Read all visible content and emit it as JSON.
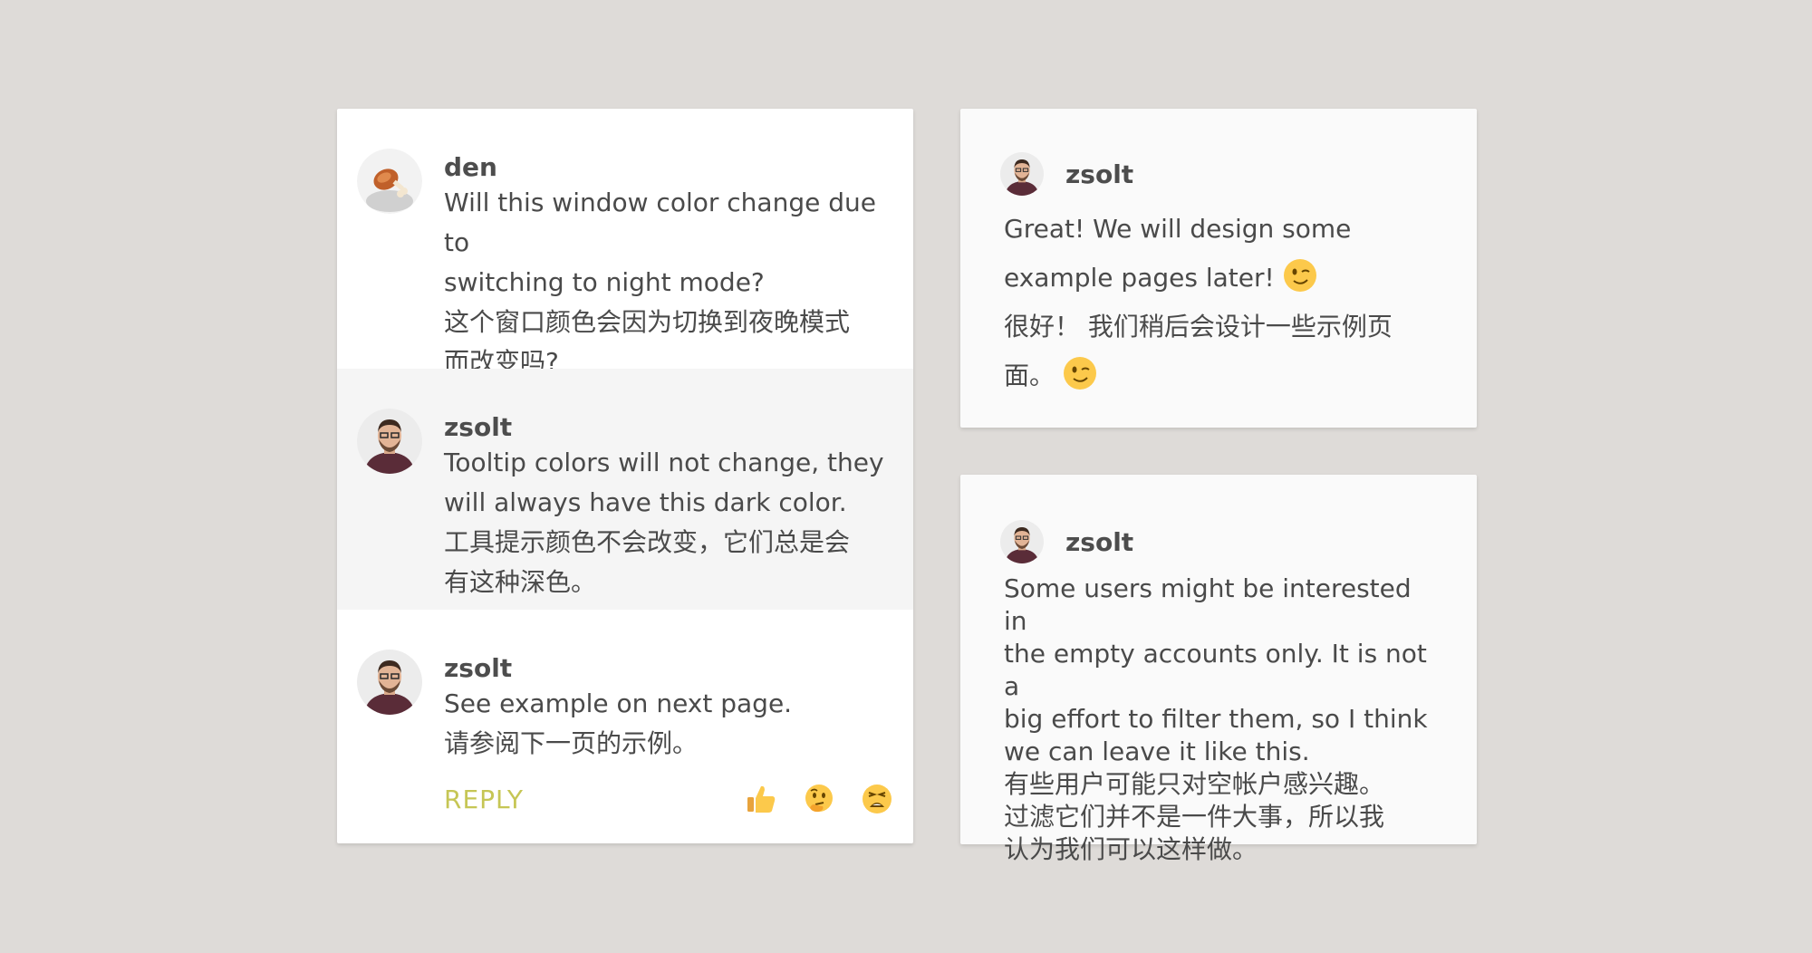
{
  "thread": {
    "comments": [
      {
        "author": "den",
        "text_en_1": "Will this window color change due to",
        "text_en_2": "switching to night mode?",
        "text_zh_1": "这个窗口颜色会因为切换到夜晚模式",
        "text_zh_2": "而改变吗?",
        "avatar": "meat-emoji-avatar"
      },
      {
        "author": "zsolt",
        "text_en_1": "Tooltip colors will not change, they",
        "text_en_2": "will always have this dark color.",
        "text_zh_1": "工具提示颜色不会改变，它们总是会",
        "text_zh_2": "有这种深色。",
        "avatar": "person-avatar"
      },
      {
        "author": "zsolt",
        "text_en_1": "See example on next page.",
        "text_zh_1": "请参阅下一页的示例。",
        "avatar": "person-avatar"
      }
    ],
    "footer": {
      "reply_label": "REPLY",
      "reactions": [
        "thumbs-up-icon",
        "thinking-face-icon",
        "weary-face-icon"
      ]
    }
  },
  "card2": {
    "author": "zsolt",
    "line1": "Great! We will design some",
    "line2": "example pages later!",
    "line3": "很好！ 我们稍后会设计一些示例页",
    "line4": "面。"
  },
  "card3": {
    "author": "zsolt",
    "line1": "Some users might be interested in",
    "line2": "the empty accounts only. It is not a",
    "line3": "big effort to filter them, so I think",
    "line4": "we can leave it like this.",
    "line5": "有些用户可能只对空帐户感兴趣。",
    "line6": "过滤它们并不是一件大事，所以我",
    "line7": "认为我们可以这样做。"
  },
  "colors": {
    "background": "#dedbd8",
    "reply": "#c6c655",
    "highlight_row": "#f5f5f5"
  }
}
